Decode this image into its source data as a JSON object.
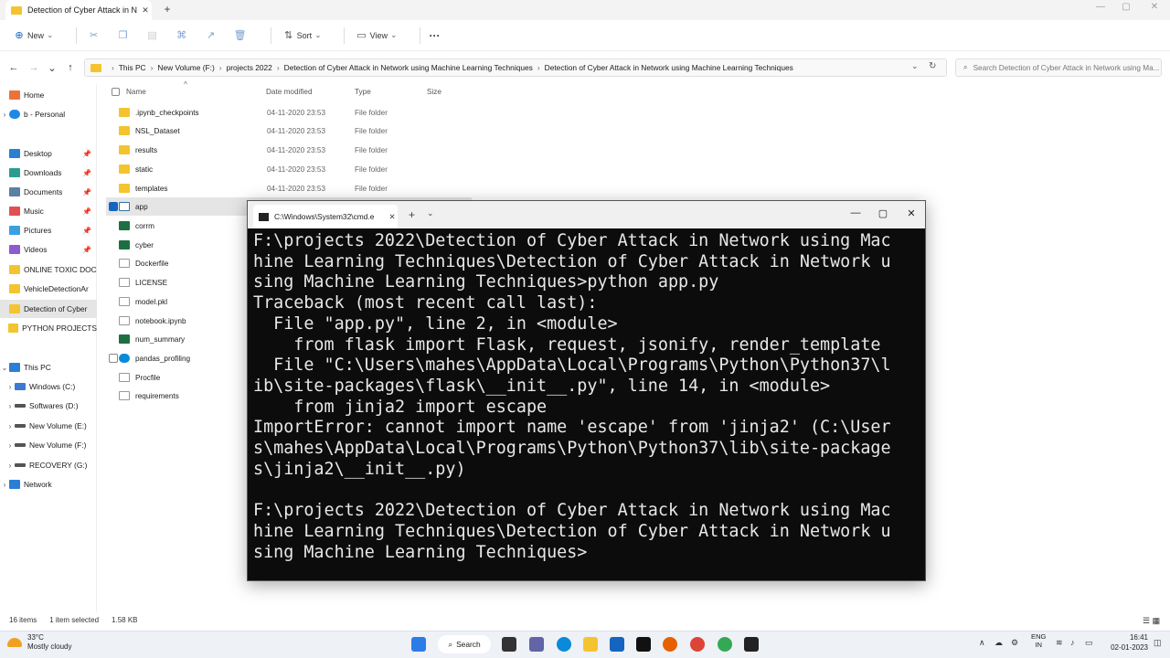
{
  "window": {
    "tab_title": "Detection of Cyber Attack in N",
    "close": "✕",
    "new_tab": "+"
  },
  "toolbar": {
    "new_label": "New",
    "sort_label": "Sort",
    "view_label": "View",
    "more_label": "···"
  },
  "address": {
    "crumbs": [
      "This PC",
      "New Volume (F:)",
      "projects 2022",
      "Detection of Cyber Attack in Network using Machine Learning Techniques",
      "Detection of Cyber Attack in Network using Machine Learning Techniques"
    ],
    "search_placeholder": "Search Detection of Cyber Attack in Network using Ma..."
  },
  "sidebar": {
    "items": [
      {
        "label": "Home",
        "icon": "home-icon"
      },
      {
        "label": "b - Personal",
        "icon": "cloud-icon"
      },
      {
        "label": "Desktop",
        "icon": "desktop-icon"
      },
      {
        "label": "Downloads",
        "icon": "download-icon"
      },
      {
        "label": "Documents",
        "icon": "document-icon"
      },
      {
        "label": "Music",
        "icon": "music-icon"
      },
      {
        "label": "Pictures",
        "icon": "picture-icon"
      },
      {
        "label": "Videos",
        "icon": "video-icon"
      },
      {
        "label": "ONLINE TOXIC DOC",
        "icon": "folder-icon"
      },
      {
        "label": "VehicleDetectionAr",
        "icon": "folder-icon"
      },
      {
        "label": "Detection of Cyber",
        "icon": "folder-icon"
      },
      {
        "label": "PYTHON PROJECTS",
        "icon": "folder-icon"
      },
      {
        "label": "This PC",
        "icon": "pc-icon"
      },
      {
        "label": "Windows (C:)",
        "icon": "drive-icon"
      },
      {
        "label": "Softwares (D:)",
        "icon": "drive-icon"
      },
      {
        "label": "New Volume (E:)",
        "icon": "drive-icon"
      },
      {
        "label": "New Volume (F:)",
        "icon": "drive-icon"
      },
      {
        "label": "RECOVERY (G:)",
        "icon": "drive-icon"
      },
      {
        "label": "Network",
        "icon": "network-icon"
      }
    ]
  },
  "file_list": {
    "headers": {
      "name": "Name",
      "date": "Date modified",
      "type": "Type",
      "size": "Size"
    },
    "rows": [
      {
        "name": ".ipynb_checkpoints",
        "date": "04-11-2020 23:53",
        "type": "File folder",
        "icon": "folder-icon"
      },
      {
        "name": "NSL_Dataset",
        "date": "04-11-2020 23:53",
        "type": "File folder",
        "icon": "folder-icon"
      },
      {
        "name": "results",
        "date": "04-11-2020 23:53",
        "type": "File folder",
        "icon": "folder-icon"
      },
      {
        "name": "static",
        "date": "04-11-2020 23:53",
        "type": "File folder",
        "icon": "folder-icon"
      },
      {
        "name": "templates",
        "date": "04-11-2020 23:53",
        "type": "File folder",
        "icon": "folder-icon"
      },
      {
        "name": "app",
        "date": "",
        "type": "",
        "icon": "python-file-icon"
      },
      {
        "name": "corrm",
        "date": "",
        "type": "",
        "icon": "excel-file-icon"
      },
      {
        "name": "cyber",
        "date": "",
        "type": "",
        "icon": "excel-file-icon"
      },
      {
        "name": "Dockerfile",
        "date": "",
        "type": "",
        "icon": "file-icon"
      },
      {
        "name": "LICENSE",
        "date": "",
        "type": "",
        "icon": "file-icon"
      },
      {
        "name": "model.pkl",
        "date": "",
        "type": "",
        "icon": "file-icon"
      },
      {
        "name": "notebook.ipynb",
        "date": "",
        "type": "",
        "icon": "file-icon"
      },
      {
        "name": "num_summary",
        "date": "",
        "type": "",
        "icon": "excel-file-icon"
      },
      {
        "name": "pandas_profiling",
        "date": "",
        "type": "",
        "icon": "edge-file-icon"
      },
      {
        "name": "Procfile",
        "date": "",
        "type": "",
        "icon": "file-icon"
      },
      {
        "name": "requirements",
        "date": "",
        "type": "",
        "icon": "text-file-icon"
      }
    ]
  },
  "status_bar": {
    "count": "16 items",
    "selected": "1 item selected",
    "size": "1.58 KB"
  },
  "cmd": {
    "tab_title": "C:\\Windows\\System32\\cmd.e",
    "text": "F:\\projects 2022\\Detection of Cyber Attack in Network using Mac\nhine Learning Techniques\\Detection of Cyber Attack in Network u\nsing Machine Learning Techniques>python app.py\nTraceback (most recent call last):\n  File \"app.py\", line 2, in <module>\n    from flask import Flask, request, jsonify, render_template\n  File \"C:\\Users\\mahes\\AppData\\Local\\Programs\\Python\\Python37\\l\nib\\site-packages\\flask\\__init__.py\", line 14, in <module>\n    from jinja2 import escape\nImportError: cannot import name 'escape' from 'jinja2' (C:\\User\ns\\mahes\\AppData\\Local\\Programs\\Python\\Python37\\lib\\site-package\ns\\jinja2\\__init__.py)\n\nF:\\projects 2022\\Detection of Cyber Attack in Network using Mac\nhine Learning Techniques\\Detection of Cyber Attack in Network u\nsing Machine Learning Techniques>"
  },
  "taskbar": {
    "temp": "33°C",
    "weather": "Mostly cloudy",
    "search_label": "Search",
    "lang_top": "ENG",
    "lang_bottom": "IN",
    "time": "16:41",
    "date": "02-01-2023"
  },
  "colors": {
    "folder": "#f4c430",
    "accent": "#1565c0",
    "cmd_bg": "#0c0c0c"
  }
}
